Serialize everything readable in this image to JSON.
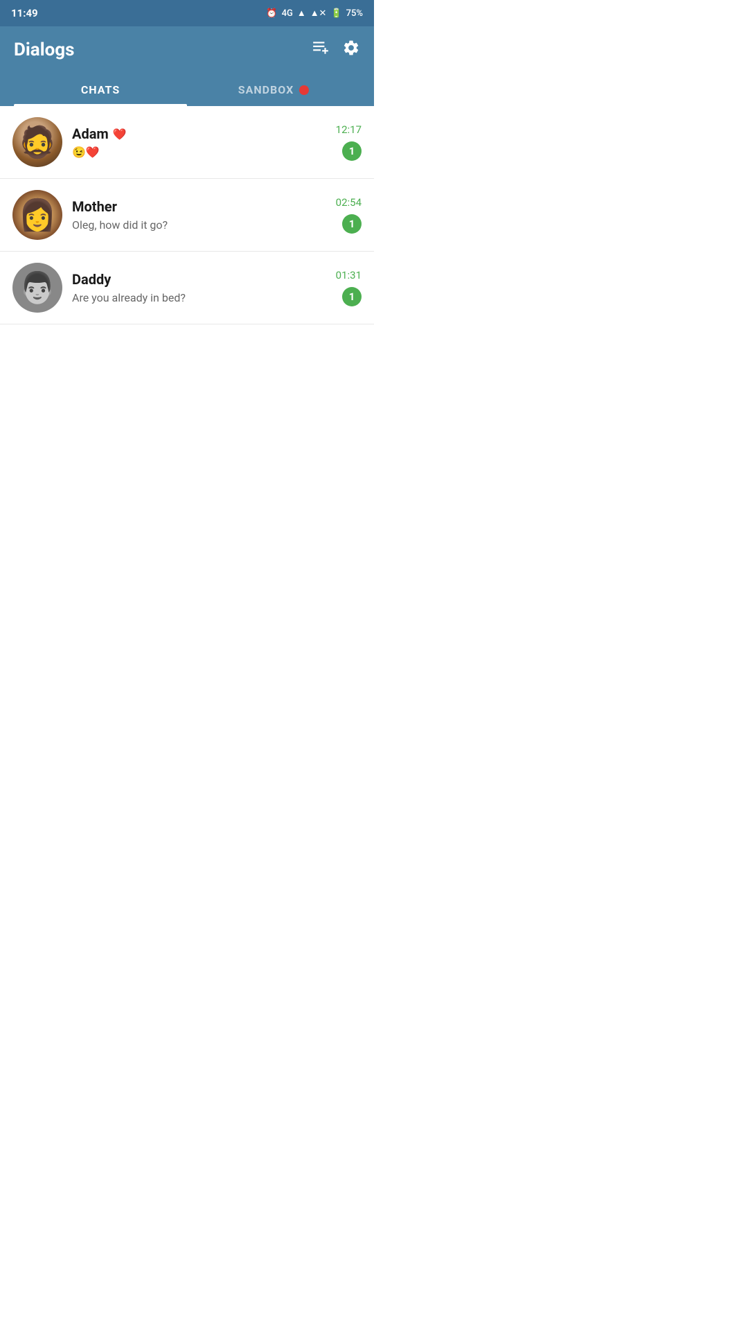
{
  "statusBar": {
    "time": "11:49",
    "battery": "75%",
    "signal": "4G"
  },
  "header": {
    "title": "Dialogs",
    "composeLabel": "compose",
    "settingsLabel": "settings"
  },
  "tabs": [
    {
      "id": "chats",
      "label": "CHATS",
      "active": true
    },
    {
      "id": "sandbox",
      "label": "SANDBOX",
      "active": false,
      "hasDot": true
    }
  ],
  "chats": [
    {
      "id": "adam",
      "name": "Adam",
      "nameEmoji": "❤️",
      "message": "😉❤️",
      "time": "12:17",
      "badge": "1",
      "avatarType": "adam"
    },
    {
      "id": "mother",
      "name": "Mother",
      "nameEmoji": "",
      "message": "Oleg, how did it go?",
      "time": "02:54",
      "badge": "1",
      "avatarType": "mother"
    },
    {
      "id": "daddy",
      "name": "Daddy",
      "nameEmoji": "",
      "message": "Are you already in bed?",
      "time": "01:31",
      "badge": "1",
      "avatarType": "daddy"
    }
  ]
}
